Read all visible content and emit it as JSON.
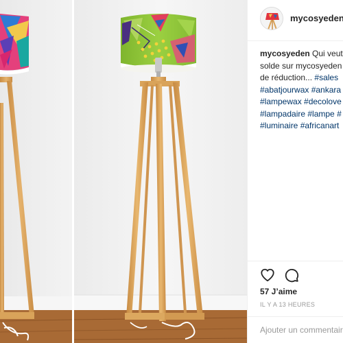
{
  "post": {
    "username": "mycosyeden",
    "caption": {
      "username": "mycosyeden",
      "lines": [
        {
          "text": "Qui veut"
        },
        {
          "text": "solde sur mycosyeden"
        },
        {
          "text": "de réduction... ",
          "tag": "#sales"
        }
      ],
      "hashtag_lines": [
        "#abatjourwax #ankara",
        "#lampewax #decolove",
        "#lampadaire #lampe #",
        "#luminaire #africanart"
      ]
    },
    "likes": "57 J’aime",
    "timestamp": "IL Y A 13 HEURES",
    "comment_placeholder": "Ajouter un commentaire"
  },
  "icons": {
    "like": "heart-icon",
    "comment": "comment-bubble-icon"
  },
  "colors": {
    "text": "#262626",
    "hashtag": "#003569",
    "muted": "#999999",
    "border": "#efefef",
    "shade_main": "#8fc53b",
    "wood": "#d9a35a",
    "floor": "#a86a35"
  }
}
